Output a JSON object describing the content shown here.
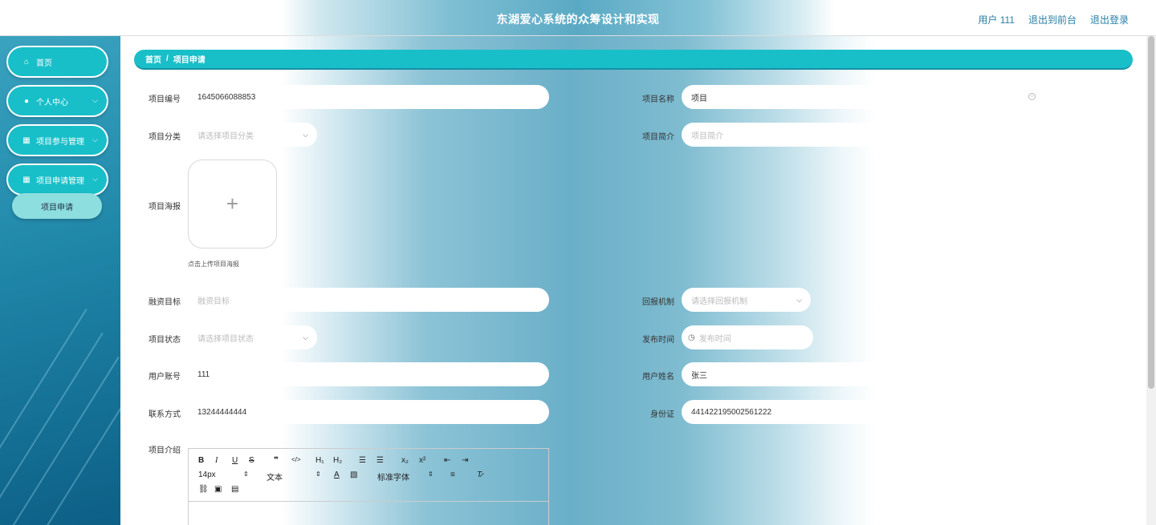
{
  "header": {
    "title": "东湖爱心系统的众筹设计和实现",
    "user_label": "用户 111",
    "back_to_front": "退出到前台",
    "logout": "退出登录"
  },
  "sidebar": {
    "items": [
      {
        "label": "首页",
        "icon": "home-icon"
      },
      {
        "label": "个人中心",
        "icon": "user-icon"
      },
      {
        "label": "项目参与管理",
        "icon": "grid-icon"
      },
      {
        "label": "项目申请管理",
        "icon": "grid-icon"
      }
    ],
    "submenu": {
      "label": "项目申请"
    }
  },
  "breadcrumb": {
    "home": "首页",
    "separator": "/",
    "current": "项目申请"
  },
  "form": {
    "project_no": {
      "label": "项目编号",
      "value": "1645066088853"
    },
    "project_name": {
      "label": "项目名称",
      "value": "项目"
    },
    "category": {
      "label": "项目分类",
      "placeholder": "请选择项目分类"
    },
    "summary": {
      "label": "项目简介",
      "placeholder": "项目简介"
    },
    "poster": {
      "label": "项目海报",
      "plus": "+",
      "tip": "点击上传项目海报"
    },
    "funding_goal": {
      "label": "融资目标",
      "placeholder": "融资目标"
    },
    "return_mechanism": {
      "label": "回报机制",
      "placeholder": "请选择回报机制"
    },
    "status": {
      "label": "项目状态",
      "placeholder": "请选择项目状态"
    },
    "publish_time": {
      "label": "发布时间",
      "placeholder": "发布时间"
    },
    "user_account": {
      "label": "用户账号",
      "value": "111"
    },
    "user_name": {
      "label": "用户姓名",
      "value": "张三"
    },
    "contact": {
      "label": "联系方式",
      "value": "13244444444"
    },
    "id_card": {
      "label": "身份证",
      "value": "441422195002561222"
    },
    "intro": {
      "label": "项目介绍"
    }
  },
  "editor_toolbar": {
    "font_size": "14px",
    "text_type": "文本",
    "font_family": "标准字体"
  },
  "colors": {
    "accent": "#19bfc8",
    "sidebar": "#1f86a8"
  }
}
